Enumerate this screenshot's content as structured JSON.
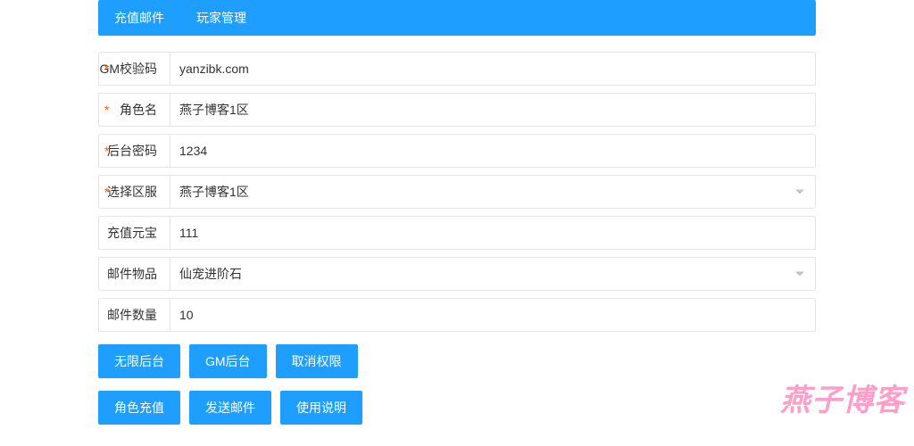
{
  "tabs": [
    {
      "label": "充值邮件"
    },
    {
      "label": "玩家管理"
    }
  ],
  "form": [
    {
      "label": "GM校验码",
      "required": true,
      "type": "text",
      "value": "yanzibk.com"
    },
    {
      "label": "角色名",
      "required": true,
      "type": "text",
      "value": "燕子博客1区"
    },
    {
      "label": "后台密码",
      "required": true,
      "type": "text",
      "value": "1234"
    },
    {
      "label": "选择区服",
      "required": true,
      "type": "select",
      "value": "燕子博客1区"
    },
    {
      "label": "充值元宝",
      "required": false,
      "type": "text",
      "value": "111"
    },
    {
      "label": "邮件物品",
      "required": false,
      "type": "select",
      "value": "仙宠进阶石"
    },
    {
      "label": "邮件数量",
      "required": false,
      "type": "text",
      "value": "10"
    }
  ],
  "button_rows": [
    [
      {
        "label": "无限后台"
      },
      {
        "label": "GM后台"
      },
      {
        "label": "取消权限"
      }
    ],
    [
      {
        "label": "角色充值"
      },
      {
        "label": "发送邮件"
      },
      {
        "label": "使用说明"
      }
    ]
  ],
  "watermark": "燕子博客"
}
